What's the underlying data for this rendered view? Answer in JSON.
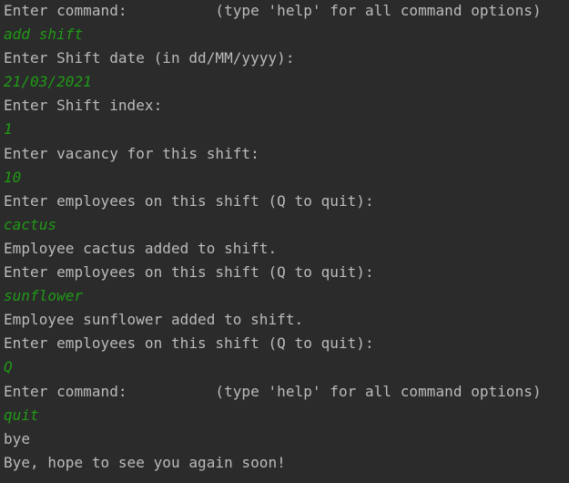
{
  "console": {
    "lines": [
      {
        "kind": "output",
        "text": "Enter command:          (type 'help' for all command options)"
      },
      {
        "kind": "input",
        "text": "add shift"
      },
      {
        "kind": "output",
        "text": "Enter Shift date (in dd/MM/yyyy):"
      },
      {
        "kind": "input",
        "text": "21/03/2021"
      },
      {
        "kind": "output",
        "text": "Enter Shift index:"
      },
      {
        "kind": "input",
        "text": "1"
      },
      {
        "kind": "output",
        "text": "Enter vacancy for this shift:"
      },
      {
        "kind": "input",
        "text": "10"
      },
      {
        "kind": "output",
        "text": "Enter employees on this shift (Q to quit):"
      },
      {
        "kind": "input",
        "text": "cactus"
      },
      {
        "kind": "output",
        "text": "Employee cactus added to shift."
      },
      {
        "kind": "output",
        "text": "Enter employees on this shift (Q to quit):"
      },
      {
        "kind": "input",
        "text": "sunflower"
      },
      {
        "kind": "output",
        "text": "Employee sunflower added to shift."
      },
      {
        "kind": "output",
        "text": "Enter employees on this shift (Q to quit):"
      },
      {
        "kind": "input",
        "text": "Q"
      },
      {
        "kind": "output",
        "text": "Enter command:          (type 'help' for all command options)"
      },
      {
        "kind": "input",
        "text": "quit"
      },
      {
        "kind": "output",
        "text": "bye"
      },
      {
        "kind": "output",
        "text": "Bye, hope to see you again soon!"
      }
    ]
  },
  "colors": {
    "background": "#2b2b2b",
    "output_text": "#bbbbbb",
    "input_text": "#1f9a16"
  }
}
